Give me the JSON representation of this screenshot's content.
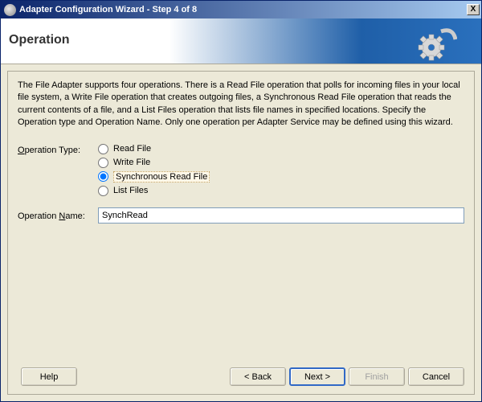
{
  "window": {
    "title": "Adapter Configuration Wizard - Step 4 of 8",
    "close_label": "X"
  },
  "header": {
    "title": "Operation"
  },
  "description": "The File Adapter supports four operations.  There is a Read File operation that polls for incoming files in your local file system, a Write File operation that creates outgoing files, a Synchronous Read File operation that reads the current contents of a file, and a List Files operation that lists file names in specified locations.  Specify the Operation type and Operation Name.  Only one operation per Adapter Service may be defined using this wizard.",
  "labels": {
    "operation_type": "Operation Type:",
    "operation_name": "Operation Name:"
  },
  "operation_type": {
    "options": {
      "read": "Read File",
      "write": "Write File",
      "sync": "Synchronous Read File",
      "list": "List Files"
    },
    "selected": "sync"
  },
  "operation_name": {
    "value": "SynchRead"
  },
  "buttons": {
    "help": "Help",
    "back": "< Back",
    "next": "Next >",
    "finish": "Finish",
    "cancel": "Cancel"
  }
}
